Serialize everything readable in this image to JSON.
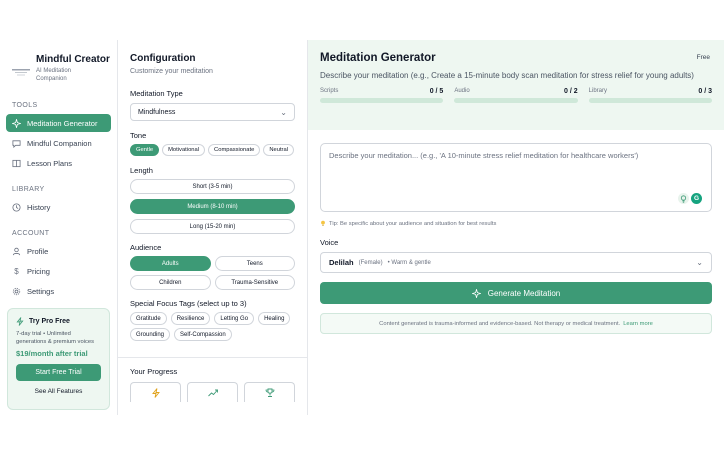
{
  "brand": {
    "title": "Mindful Creator",
    "subtitle_line1": "AI Meditation",
    "subtitle_line2": "Companion"
  },
  "sidebar": {
    "tools_label": "TOOLS",
    "library_label": "LIBRARY",
    "account_label": "ACCOUNT",
    "items": [
      {
        "label": "Meditation Generator",
        "icon": "sparkle-icon",
        "active": true
      },
      {
        "label": "Mindful Companion",
        "icon": "chat-icon"
      },
      {
        "label": "Lesson Plans",
        "icon": "book-icon"
      },
      {
        "label": "History",
        "icon": "clock-icon"
      },
      {
        "label": "Profile",
        "icon": "user-icon"
      },
      {
        "label": "Pricing",
        "icon": "dollar-icon"
      },
      {
        "label": "Settings",
        "icon": "gear-icon"
      }
    ],
    "pro": {
      "title": "Try Pro Free",
      "desc_line1": "7-day trial • Unlimited",
      "desc_line2": "generations & premium voices",
      "price": "$19/month after trial",
      "button": "Start Free Trial",
      "link": "See All Features"
    }
  },
  "config": {
    "title": "Configuration",
    "subtitle": "Customize your meditation",
    "type_label": "Meditation Type",
    "type_value": "Mindfulness",
    "tone_label": "Tone",
    "tones": [
      "Gentle",
      "Motivational",
      "Compassionate",
      "Neutral"
    ],
    "tone_selected": "Gentle",
    "length_label": "Length",
    "lengths": [
      "Short (3-5 min)",
      "Medium (8-10 min)",
      "Long (15-20 min)"
    ],
    "length_selected": "Medium (8-10 min)",
    "audience_label": "Audience",
    "audiences": [
      "Adults",
      "Teens",
      "Children",
      "Trauma-Sensitive"
    ],
    "audience_selected": "Adults",
    "tags_label": "Special Focus Tags (select up to 3)",
    "tags": [
      "Gratitude",
      "Resilience",
      "Letting Go",
      "Healing",
      "Grounding",
      "Self-Compassion"
    ],
    "progress_label": "Your Progress"
  },
  "main": {
    "title": "Meditation Generator",
    "plan": "Free",
    "description": "Describe your meditation (e.g., Create a 15-minute body scan meditation for stress relief for young adults)",
    "quotas": [
      {
        "label": "Scripts",
        "count": "0 / 5",
        "fraction": 0
      },
      {
        "label": "Audio",
        "count": "0 / 2",
        "fraction": 0
      },
      {
        "label": "Library",
        "count": "0 / 3",
        "fraction": 0
      }
    ],
    "prompt_placeholder": "Describe your meditation... (e.g., 'A 10-minute stress relief meditation for healthcare workers')",
    "tip": "Tip: Be specific about your audience and situation for best results",
    "voice_label": "Voice",
    "voice_name": "Delilah",
    "voice_gender": "(Female)",
    "voice_desc": "• Warm & gentle",
    "generate_button": "Generate Meditation",
    "notice": "Content generated is trauma-informed and evidence-based. Not therapy or medical treatment.",
    "notice_link": "Learn more"
  },
  "colors": {
    "accent": "#3d9a76",
    "header_bg": "#eef7f1"
  }
}
